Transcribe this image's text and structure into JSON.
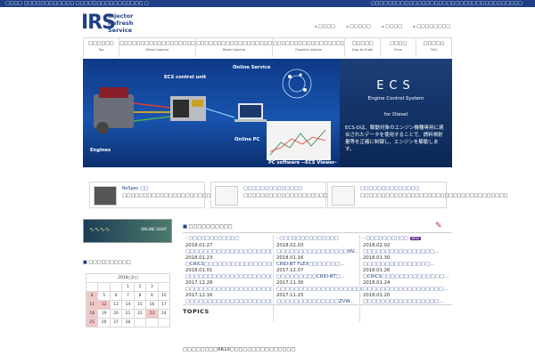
{
  "topbar": {
    "left": "□□□□ □□□□□□□□□□□□ □□□□□□□□□□□□□□□□ □",
    "right": "□□□□□□□□□□□□□□□□□□□□□□□□□□□□□□□□□□□□"
  },
  "logo": {
    "big": "IRS",
    "line1": "Injector",
    "line2": "Refresh",
    "line3": "Service"
  },
  "toplinks": [
    "□□□□",
    "□□□□□",
    "□□□□",
    "□□□□□□□□"
  ],
  "nav": [
    {
      "jp": "□□□□□□",
      "en": "Top"
    },
    {
      "jp": "□□□□□□□□□□□□□□□□□□",
      "en": "Diesel Injector"
    },
    {
      "jp": "□□□□□□□□□□□□□□□□□□",
      "en": "Diesel Injector"
    },
    {
      "jp": "□□□□□□□□□□□□□□□□□",
      "en": "Gasoline Injector"
    },
    {
      "jp": "□□□□□",
      "en": "How to Order"
    },
    {
      "jp": "□□□□",
      "en": "Price"
    },
    {
      "jp": "□□□□□",
      "en": "FAQ"
    }
  ],
  "hero": {
    "ecu": "ECS control unit",
    "online": "Online Service",
    "pc": "Online PC",
    "engines": "Engines",
    "software": "PC software --ECS Viewer-",
    "title": "ECS",
    "subtitle": "Engine Control System",
    "diesel": "for Diesel",
    "desc": "ECS-Dは、駆動対象のエンジン機種専用に適合されたデータを使用することで、燃料噴射量等を正確に制御し、エンジンを駆動します。"
  },
  "features": [
    {
      "title": "ReSpec □□",
      "desc": "□□□□□□□□□□□□□□□□□□□□□□□□□□□□□□□□□□□□"
    },
    {
      "title": "□□□□□□□□□□□□□□",
      "desc": "□□□□□□□□□□□□□□□□□□□□□□□□□□□□□□□□□□□□□□□□"
    },
    {
      "title": "□□□□□□□□□□□□□□",
      "desc": "□□□□□□□□□□□□□□□□□□□□□□□□□□□□□□□□□□□"
    }
  ],
  "shop": {
    "label": "ONLINE SHOP"
  },
  "calendar": {
    "heading": "□□□□□□□□□□",
    "month": "2018□2□",
    "rows": [
      [
        "",
        "",
        "",
        "1",
        "2",
        "3",
        ""
      ],
      [
        "4",
        "5",
        "6",
        "7",
        "8",
        "9",
        "10"
      ],
      [
        "11",
        "12",
        "13",
        "14",
        "15",
        "16",
        "17"
      ],
      [
        "18",
        "19",
        "20",
        "21",
        "22",
        "23",
        "24"
      ],
      [
        "25",
        "26",
        "27",
        "28",
        "",
        "",
        ""
      ]
    ]
  },
  "news": {
    "heading": "□□□□□□□□□□",
    "columns": [
      {
        "head": "□□□□□□□□□□□□",
        "items": [
          {
            "date": "2018.01.27",
            "text": "□□□□□□□□□□□□□□□□□□□□□..."
          },
          {
            "date": "2018.01.23",
            "text": "□CRICS□□□□□□□□□□□□□□□□□□..."
          },
          {
            "date": "2018.01.01",
            "text": "□□□□□□□□□□□□□□□□□□□□□□..."
          },
          {
            "date": "2017.12.28",
            "text": "□□□□□□□□□□□□□□□□□□□□□□..."
          },
          {
            "date": "2017.12.16",
            "text": "□□□□□□□□□□□□□□□□□□□□□□..."
          }
        ]
      },
      {
        "head": "□□□□□□□□□□□□□□",
        "items": [
          {
            "date": "2018.02.03",
            "text": "□□□□□□□□□□□□□□□□NV..."
          },
          {
            "date": "2018.01.16",
            "text": "CRID-BT FLEX□□□□□□□..."
          },
          {
            "date": "2017.12.07",
            "text": "□□□□□□□□□CRID-BT□..."
          },
          {
            "date": "2017.11.30",
            "text": "□□□□□□□□□□□□□□□□□□□□..."
          },
          {
            "date": "2017.11.25",
            "text": "□□□□□□□□□□□□□□ZVW..."
          }
        ]
      },
      {
        "head": "□□□□□□□□□□",
        "badge": "NEW",
        "items": [
          {
            "date": "2018.02.02",
            "text": "□□□□□□□□□□□□□□□□..."
          },
          {
            "date": "2018.01.30",
            "text": "□□□□□□□□□□□□□□□..."
          },
          {
            "date": "2018.01.26",
            "text": "□CRICS□□□□□□□□□□□□□□..."
          },
          {
            "date": "2018.01.24",
            "text": "□□□□□□□□□□□□□□□□□□..."
          },
          {
            "date": "2018.01.20",
            "text": "□□□□□□□□□□□□□□□□□..."
          }
        ]
      }
    ]
  },
  "topics": {
    "heading": "TOPICS",
    "item": "□□□□□□□□6R10□□□□□□□□□□□□□□□"
  },
  "colors": {
    "brand": "#1f3f86",
    "heroBlue": "#1854b0"
  }
}
